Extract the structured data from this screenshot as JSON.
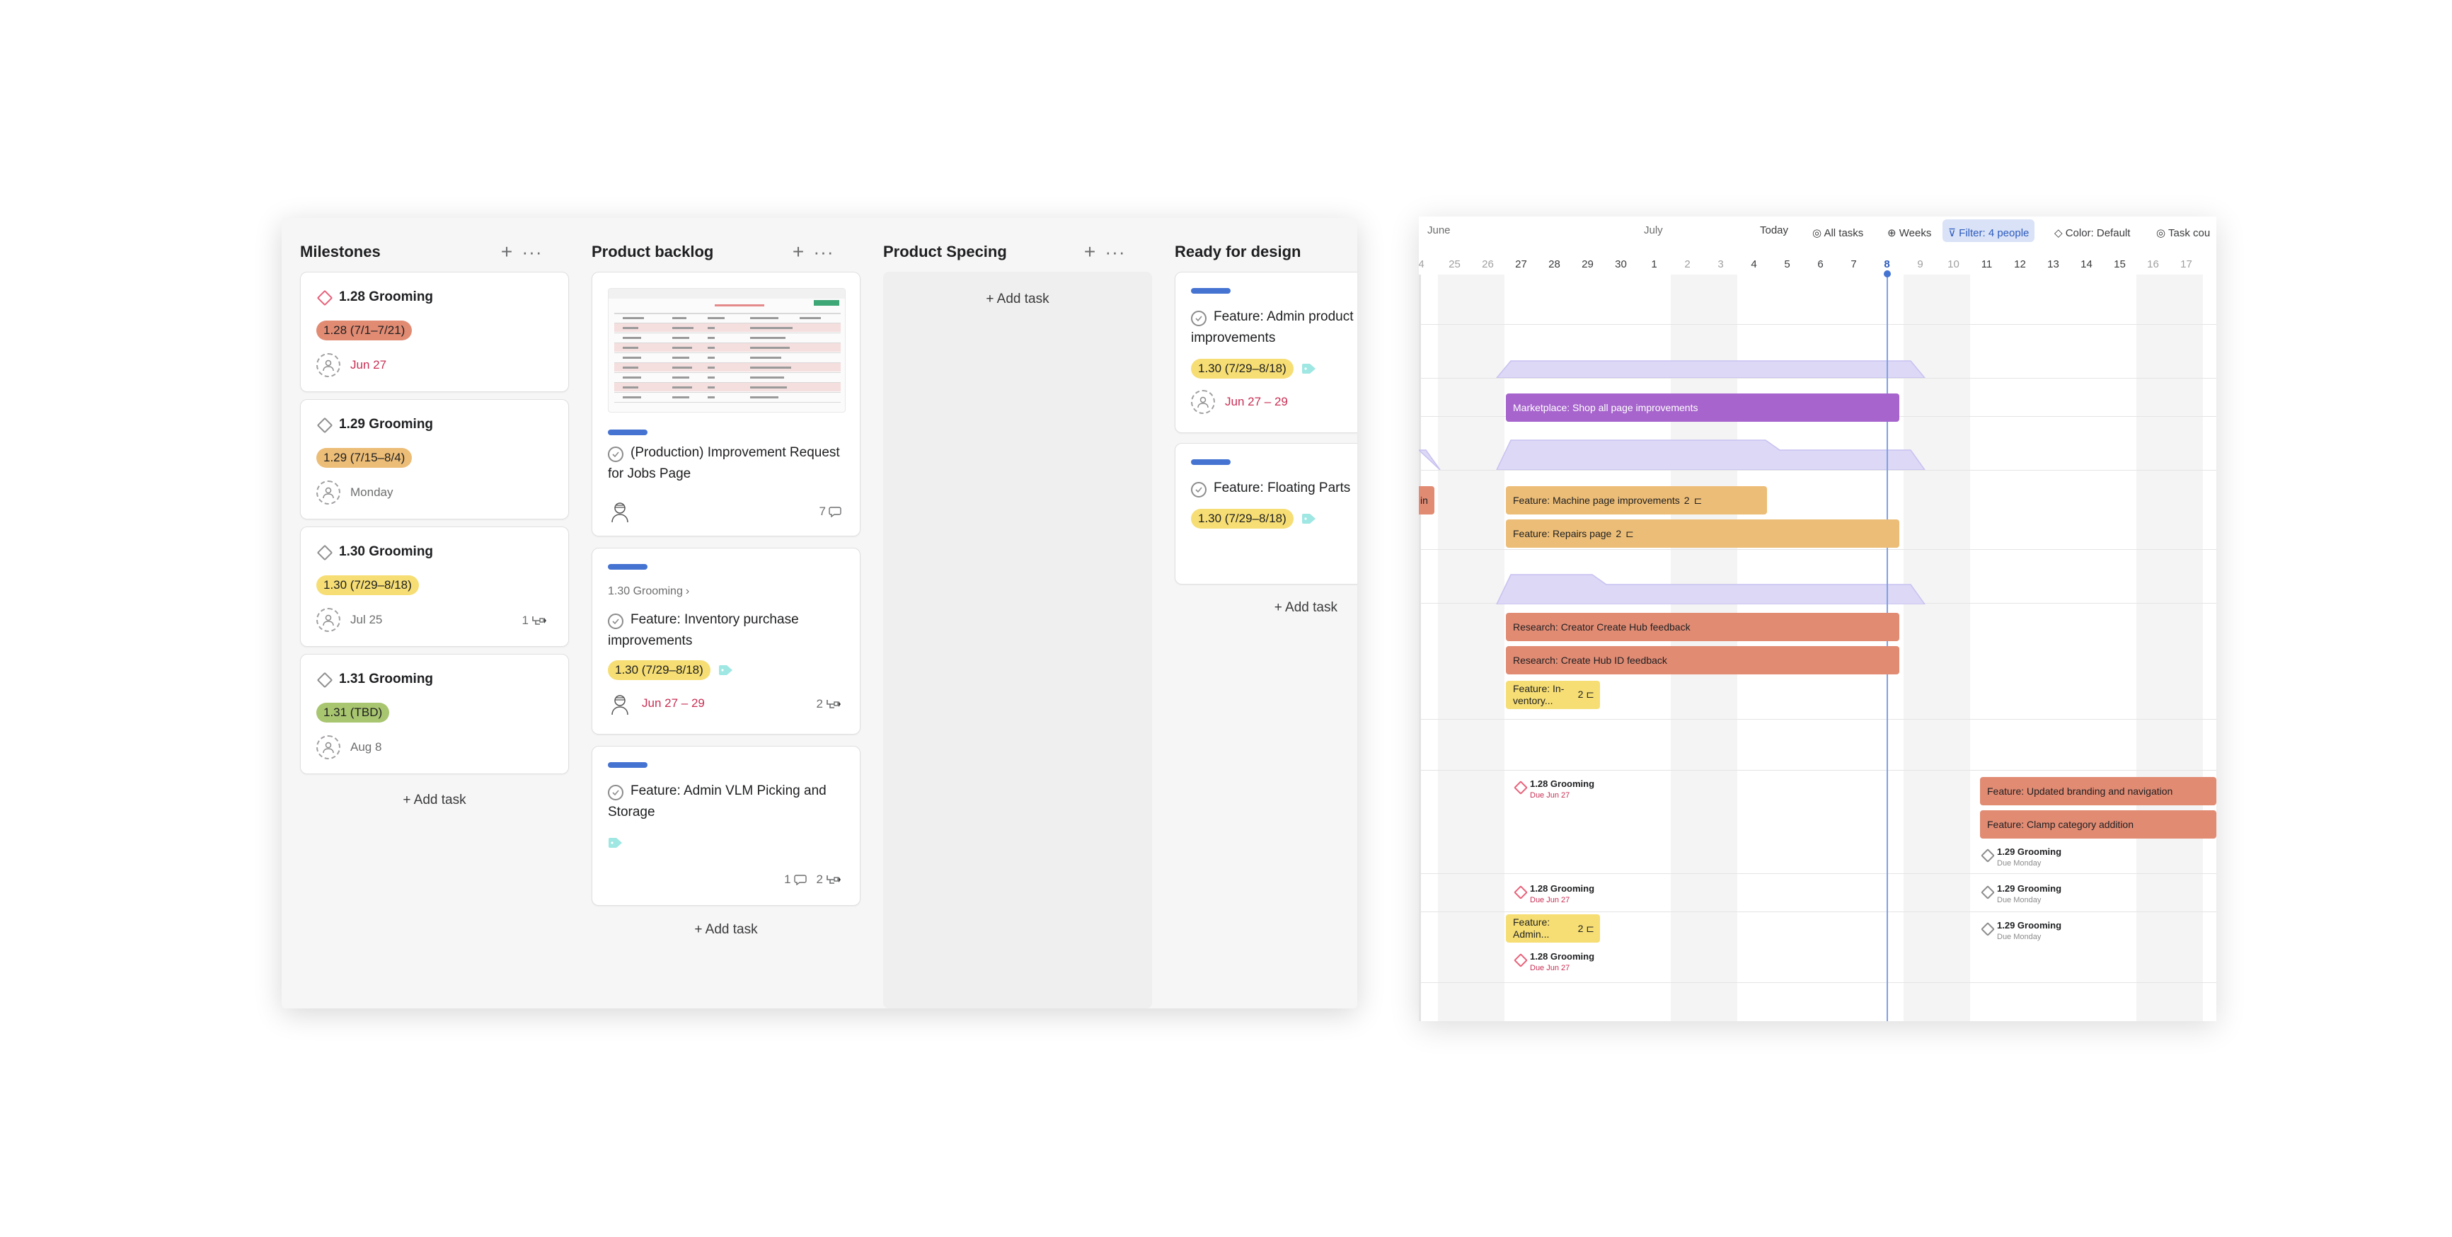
{
  "board": {
    "columns": [
      {
        "title": "Milestones",
        "cards": [
          {
            "title": "1.28 Grooming",
            "pill": "1.28 (7/1–7/21)",
            "pill_color": "#e18b73",
            "due": "Jun 27",
            "due_red": true
          },
          {
            "title": "1.29 Grooming",
            "pill": "1.29 (7/15–8/4)",
            "pill_color": "#ecbd77",
            "due": "Monday",
            "due_red": false
          },
          {
            "title": "1.30 Grooming",
            "pill": "1.30 (7/29–8/18)",
            "pill_color": "#f6de74",
            "due": "Jul 25",
            "due_red": false,
            "subtasks": "1"
          },
          {
            "title": "1.31 Grooming",
            "pill": "1.31 (TBD)",
            "pill_color": "#a8c56f",
            "due": "Aug 8",
            "due_red": false
          }
        ],
        "add_task": "+ Add task"
      },
      {
        "title": "Product backlog",
        "cards": [
          {
            "title": "(Production) Improvement Request for Jobs Page",
            "comments": "7"
          },
          {
            "parent": "1.30 Grooming",
            "title": "Feature: Inventory purchase improvements",
            "pill": "1.30 (7/29–8/18)",
            "due": "Jun 27 – 29",
            "subtasks": "2"
          },
          {
            "title": "Feature: Admin VLM Picking and Storage",
            "comments": "1",
            "subtasks": "2"
          }
        ],
        "add_task": "+ Add task"
      },
      {
        "title": "Product Specing",
        "add_task": "+ Add task"
      },
      {
        "title": "Ready for design",
        "cards": [
          {
            "title": "Feature: Admin product improvements",
            "pill": "1.30 (7/29–8/18)",
            "due": "Jun 27 – 29"
          },
          {
            "title": "Feature: Floating Parts",
            "pill": "1.30 (7/29–8/18)"
          }
        ],
        "add_task": "+ Add task"
      }
    ]
  },
  "timeline": {
    "months": [
      "June",
      "July"
    ],
    "toolbar": {
      "today": "Today",
      "all_tasks": "All tasks",
      "weeks": "Weeks",
      "filter": "Filter: 4 people",
      "color": "Color: Default",
      "task_count": "Task cou"
    },
    "days": [
      "4",
      "25",
      "26",
      "27",
      "28",
      "29",
      "30",
      "1",
      "2",
      "3",
      "4",
      "5",
      "6",
      "7",
      "8",
      "9",
      "10",
      "11",
      "12",
      "13",
      "14",
      "15",
      "16",
      "17",
      "1"
    ],
    "bars": {
      "marketplace": "Marketplace: Shop all page improvements",
      "machine": "Feature: Machine page improvements",
      "machine_sub": "2",
      "repairs": "Feature: Repairs page",
      "repairs_sub": "2",
      "creator": "Research: Creator Create Hub feedback",
      "hub": "Research: Create Hub ID feedback",
      "inventory_l1": "Feature: In-",
      "inventory_l2": "ventory...",
      "inventory_sub": "2",
      "branding": "Feature: Updated branding and navigation",
      "clamp": "Feature: Clamp category addition",
      "admin_l1": "Feature:",
      "admin_l2": "Admin...",
      "admin_sub": "2",
      "left_edge": "in"
    },
    "milestones": {
      "g128": "1.28 Grooming",
      "g128_due": "Due Jun 27",
      "g129": "1.29 Grooming",
      "g129_due": "Due Monday"
    }
  }
}
